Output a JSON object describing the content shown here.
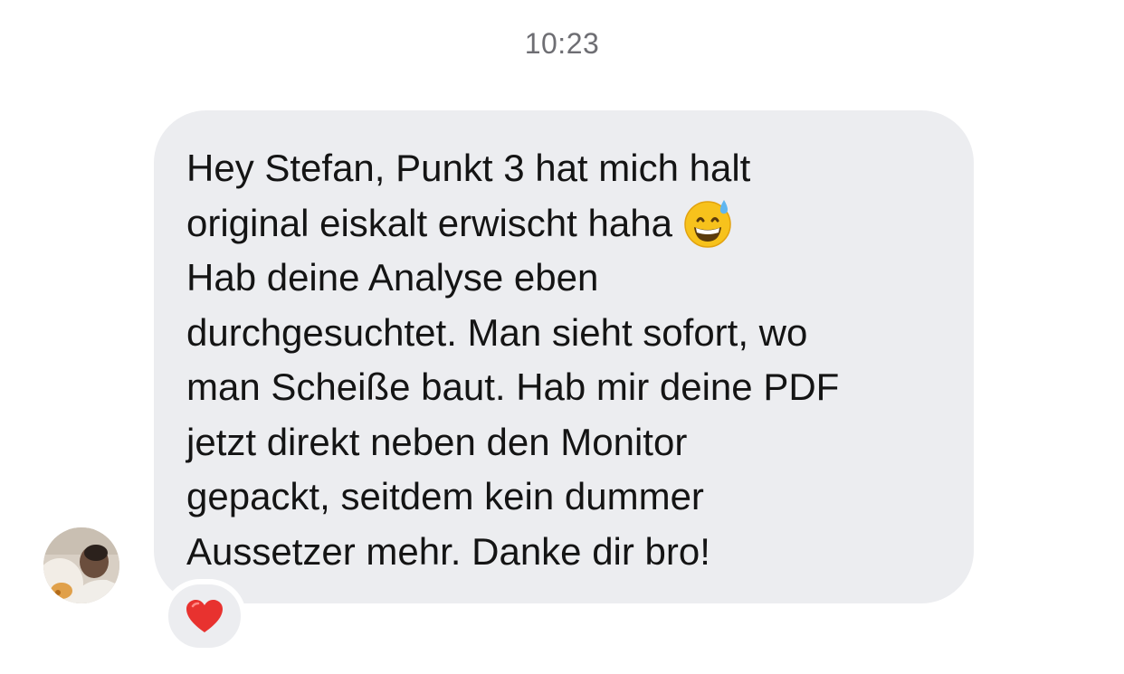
{
  "chat": {
    "timestamp": "10:23",
    "message": {
      "sender": "incoming",
      "lines": [
        "Hey Stefan, Punkt 3 hat mich halt",
        "original eiskalt erwischt haha",
        "Hab deine Analyse eben",
        "durchgesuchtet. Man sieht sofort, wo",
        "man Scheiße baut. Hab mir deine PDF",
        "jetzt direkt neben den Monitor",
        "gepackt, seitdem kein dummer",
        "Aussetzer mehr. Danke dir bro!"
      ],
      "inline_emoji": "grinning-face-with-sweat-icon",
      "reaction": "red-heart-icon"
    },
    "colors": {
      "bubble": "#ecedf0",
      "text": "#141414",
      "timestamp": "#6e6e73",
      "reaction_heart": "#e8322f"
    }
  }
}
